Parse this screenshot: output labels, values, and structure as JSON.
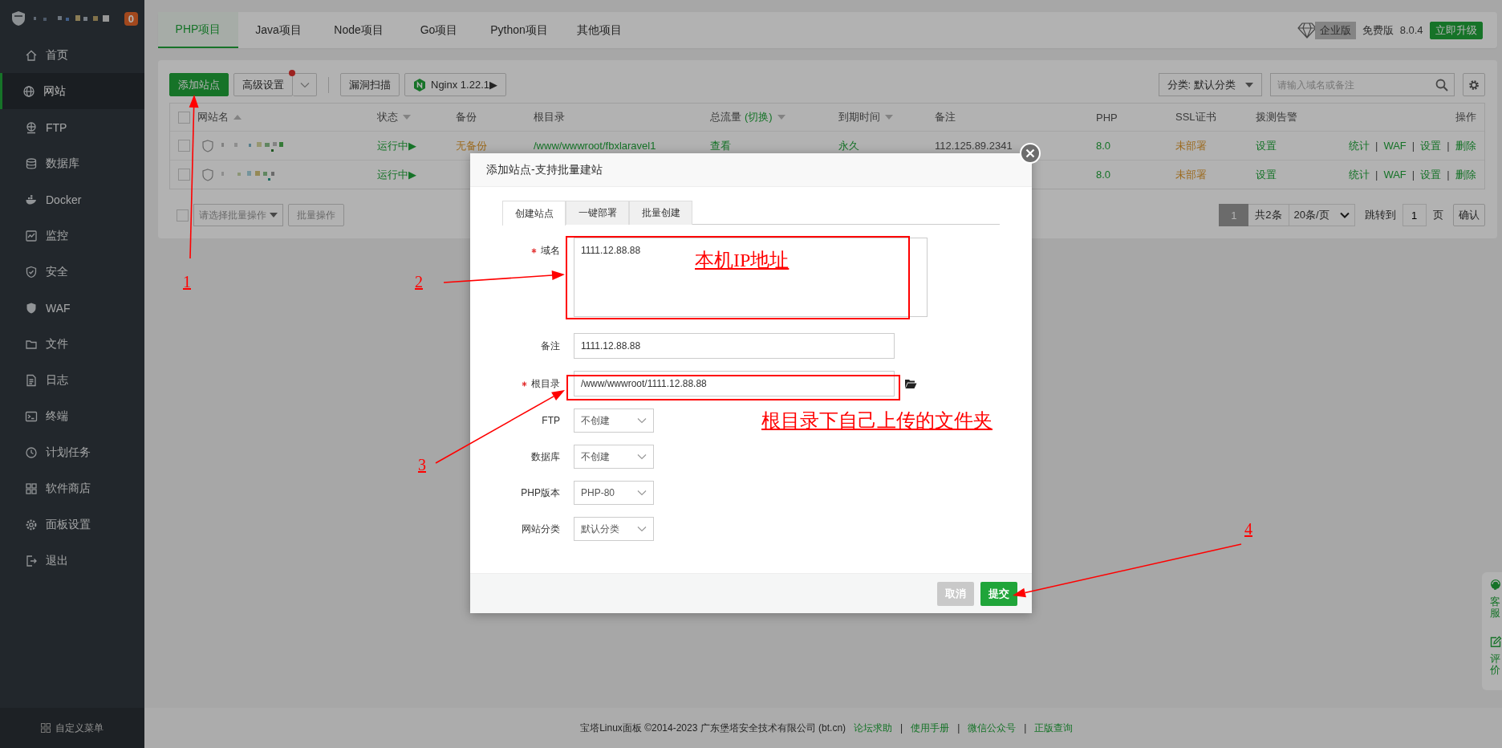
{
  "sidebar": {
    "badge": "0",
    "items": [
      {
        "label": "首页",
        "selected": false
      },
      {
        "label": "网站",
        "selected": true
      },
      {
        "label": "FTP",
        "selected": false
      },
      {
        "label": "数据库",
        "selected": false
      },
      {
        "label": "Docker",
        "selected": false
      },
      {
        "label": "监控",
        "selected": false
      },
      {
        "label": "安全",
        "selected": false
      },
      {
        "label": "WAF",
        "selected": false
      },
      {
        "label": "文件",
        "selected": false
      },
      {
        "label": "日志",
        "selected": false
      },
      {
        "label": "终端",
        "selected": false
      },
      {
        "label": "计划任务",
        "selected": false
      },
      {
        "label": "软件商店",
        "selected": false
      },
      {
        "label": "面板设置",
        "selected": false
      },
      {
        "label": "退出",
        "selected": false
      }
    ],
    "custom_menu": "自定义菜单"
  },
  "project_tabs": [
    {
      "label": "PHP项目",
      "selected": true
    },
    {
      "label": "Java项目",
      "selected": false
    },
    {
      "label": "Node项目",
      "selected": false
    },
    {
      "label": "Go项目",
      "selected": false
    },
    {
      "label": "Python项目",
      "selected": false
    },
    {
      "label": "其他项目",
      "selected": false
    }
  ],
  "edition": {
    "enterprise": "企业版",
    "free": "免费版",
    "version": "8.0.4",
    "upgrade": "立即升级"
  },
  "toolbar": {
    "add_site": "添加站点",
    "advanced": "高级设置",
    "advanced_notice": true,
    "scan": "漏洞扫描",
    "nginx": "Nginx 1.22.1▶",
    "category": "分类: 默认分类",
    "search_placeholder": "请输入域名或备注"
  },
  "table": {
    "all_checked": false,
    "columns": [
      {
        "label": "网站名",
        "sortable": true,
        "ascending": true
      },
      {
        "label": "状态",
        "sortable": true,
        "ascending": false
      },
      {
        "label": "备份"
      },
      {
        "label": "根目录"
      },
      {
        "label": "总流量",
        "link": "(切换)",
        "sortable": true,
        "ascending": false
      },
      {
        "label": "到期时间",
        "sortable": true,
        "ascending": false
      },
      {
        "label": "备注"
      },
      {
        "label": "PHP"
      },
      {
        "label": "SSL证书"
      },
      {
        "label": "拨测告警"
      },
      {
        "label": "操作"
      }
    ],
    "rows": [
      {
        "checked": false,
        "status": "运行中▶",
        "backup": "无备份",
        "path": "/www/wwwroot/fbxlaravel1",
        "traffic": "查看",
        "expiry": "永久",
        "remark": "112.125.89.2341",
        "php": "8.0",
        "ssl": "未部署",
        "alert": "设置",
        "actions": [
          "统计",
          "WAF",
          "设置",
          "删除"
        ]
      },
      {
        "checked": false,
        "status": "运行中▶",
        "php": "8.0",
        "ssl": "未部署",
        "alert": "设置",
        "actions": [
          "统计",
          "WAF",
          "设置",
          "删除"
        ]
      }
    ],
    "action_separator": "|"
  },
  "batch": {
    "checked": false,
    "select": "请选择批量操作",
    "button": "批量操作"
  },
  "pagination": {
    "pages": [
      {
        "label": "1",
        "selected": true
      }
    ],
    "total": "共2条",
    "per_page": "20条/页",
    "goto": "跳转到",
    "page_value": "1",
    "page_unit": "页",
    "confirm": "确认"
  },
  "dialog": {
    "title": "添加站点-支持批量建站",
    "tabs": [
      {
        "label": "创建站点",
        "selected": true
      },
      {
        "label": "一键部署",
        "selected": false
      },
      {
        "label": "批量创建",
        "selected": false
      }
    ],
    "fields": [
      {
        "kind": "textarea",
        "label": "域名",
        "required": true,
        "value": "1111.12.88.88"
      },
      {
        "kind": "input",
        "label": "备注",
        "required": false,
        "value": "1111.12.88.88"
      },
      {
        "kind": "path",
        "label": "根目录",
        "required": true,
        "value": "/www/wwwroot/1111.12.88.88"
      },
      {
        "kind": "select",
        "label": "FTP",
        "required": false,
        "value": "不创建"
      },
      {
        "kind": "select",
        "label": "数据库",
        "required": false,
        "value": "不创建"
      },
      {
        "kind": "select",
        "label": "PHP版本",
        "required": false,
        "value": "PHP-80"
      },
      {
        "kind": "select",
        "label": "网站分类",
        "required": false,
        "value": "默认分类"
      }
    ],
    "buttons": [
      {
        "kind": "cancel",
        "label": "取消"
      },
      {
        "kind": "submit",
        "label": "提交"
      }
    ]
  },
  "footer": {
    "copyright": "宝塔Linux面板 ©2014-2023 广东堡塔安全技术有限公司 (bt.cn)",
    "links": [
      "论坛求助",
      "使用手册",
      "微信公众号",
      "正版查询"
    ],
    "separator": "|"
  },
  "side_widget": [
    "客服",
    "评价"
  ],
  "annotations": {
    "markers": [
      "1",
      "2",
      "3",
      "4"
    ],
    "notes": [
      "本机IP地址",
      "根目录下自己上传的文件夹"
    ]
  }
}
